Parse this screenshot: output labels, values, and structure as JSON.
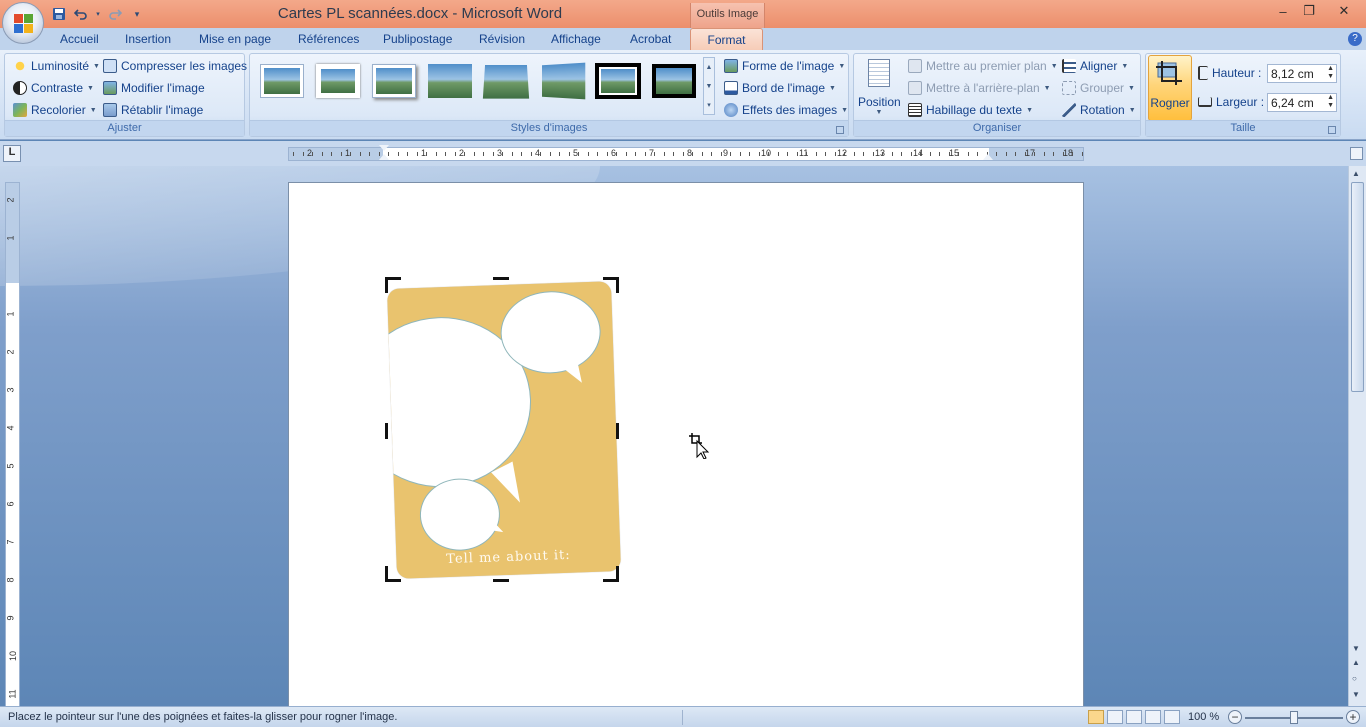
{
  "titlebar": {
    "title": "Cartes PL scannées.docx - Microsoft Word",
    "contextual_tab_group": "Outils Image",
    "minimize": "–",
    "restore": "❐",
    "close": "✕"
  },
  "quick_access": {
    "save_icon": "save-icon",
    "undo_icon": "undo-icon",
    "redo_icon": "redo-icon",
    "customize_icon": "customize-qat-icon"
  },
  "tabs": [
    {
      "label": "Accueil"
    },
    {
      "label": "Insertion"
    },
    {
      "label": "Mise en page"
    },
    {
      "label": "Références"
    },
    {
      "label": "Publipostage"
    },
    {
      "label": "Révision"
    },
    {
      "label": "Affichage"
    },
    {
      "label": "Acrobat"
    },
    {
      "label": "Format",
      "active": true
    }
  ],
  "ribbon": {
    "ajuster": {
      "label": "Ajuster",
      "luminosite": "Luminosité",
      "contraste": "Contraste",
      "recolorier": "Recolorier",
      "compresser": "Compresser les images",
      "modifier": "Modifier l'image",
      "retablir": "Rétablir l'image"
    },
    "styles": {
      "label": "Styles d'images",
      "forme": "Forme de l'image",
      "bord": "Bord de l'image",
      "effets": "Effets des images"
    },
    "organiser": {
      "label": "Organiser",
      "position": "Position",
      "premier_plan": "Mettre au premier plan",
      "arriere_plan": "Mettre à l'arrière-plan",
      "habillage": "Habillage du texte",
      "aligner": "Aligner",
      "grouper": "Grouper",
      "rotation": "Rotation"
    },
    "taille": {
      "label": "Taille",
      "rogner": "Rogner",
      "hauteur_label": "Hauteur :",
      "hauteur_value": "8,12 cm",
      "largeur_label": "Largeur :",
      "largeur_value": "6,24 cm"
    }
  },
  "ruler": {
    "corner": "L",
    "h_numbers": [
      "2",
      "1",
      "1",
      "2",
      "3",
      "4",
      "5",
      "6",
      "7",
      "8",
      "9",
      "10",
      "11",
      "12",
      "13",
      "14",
      "15",
      "17",
      "18"
    ],
    "v_numbers": [
      "2",
      "1",
      "1",
      "2",
      "3",
      "4",
      "5",
      "6",
      "7",
      "8",
      "9",
      "10",
      "11"
    ]
  },
  "document": {
    "card_text": "Tell me about it:"
  },
  "statusbar": {
    "message": "Placez le pointeur sur l'une des poignées et faites-la glisser pour rogner l'image.",
    "zoom": "100 %",
    "zoom_level_fraction": 0.5,
    "zoom_minus": "−",
    "zoom_plus": "+"
  },
  "colors": {
    "title_bar": "#ec8f6c",
    "contextual_tab": "#f6cbb6",
    "card": "#e9c36e",
    "bubble_outline": "#8fb6ba"
  }
}
